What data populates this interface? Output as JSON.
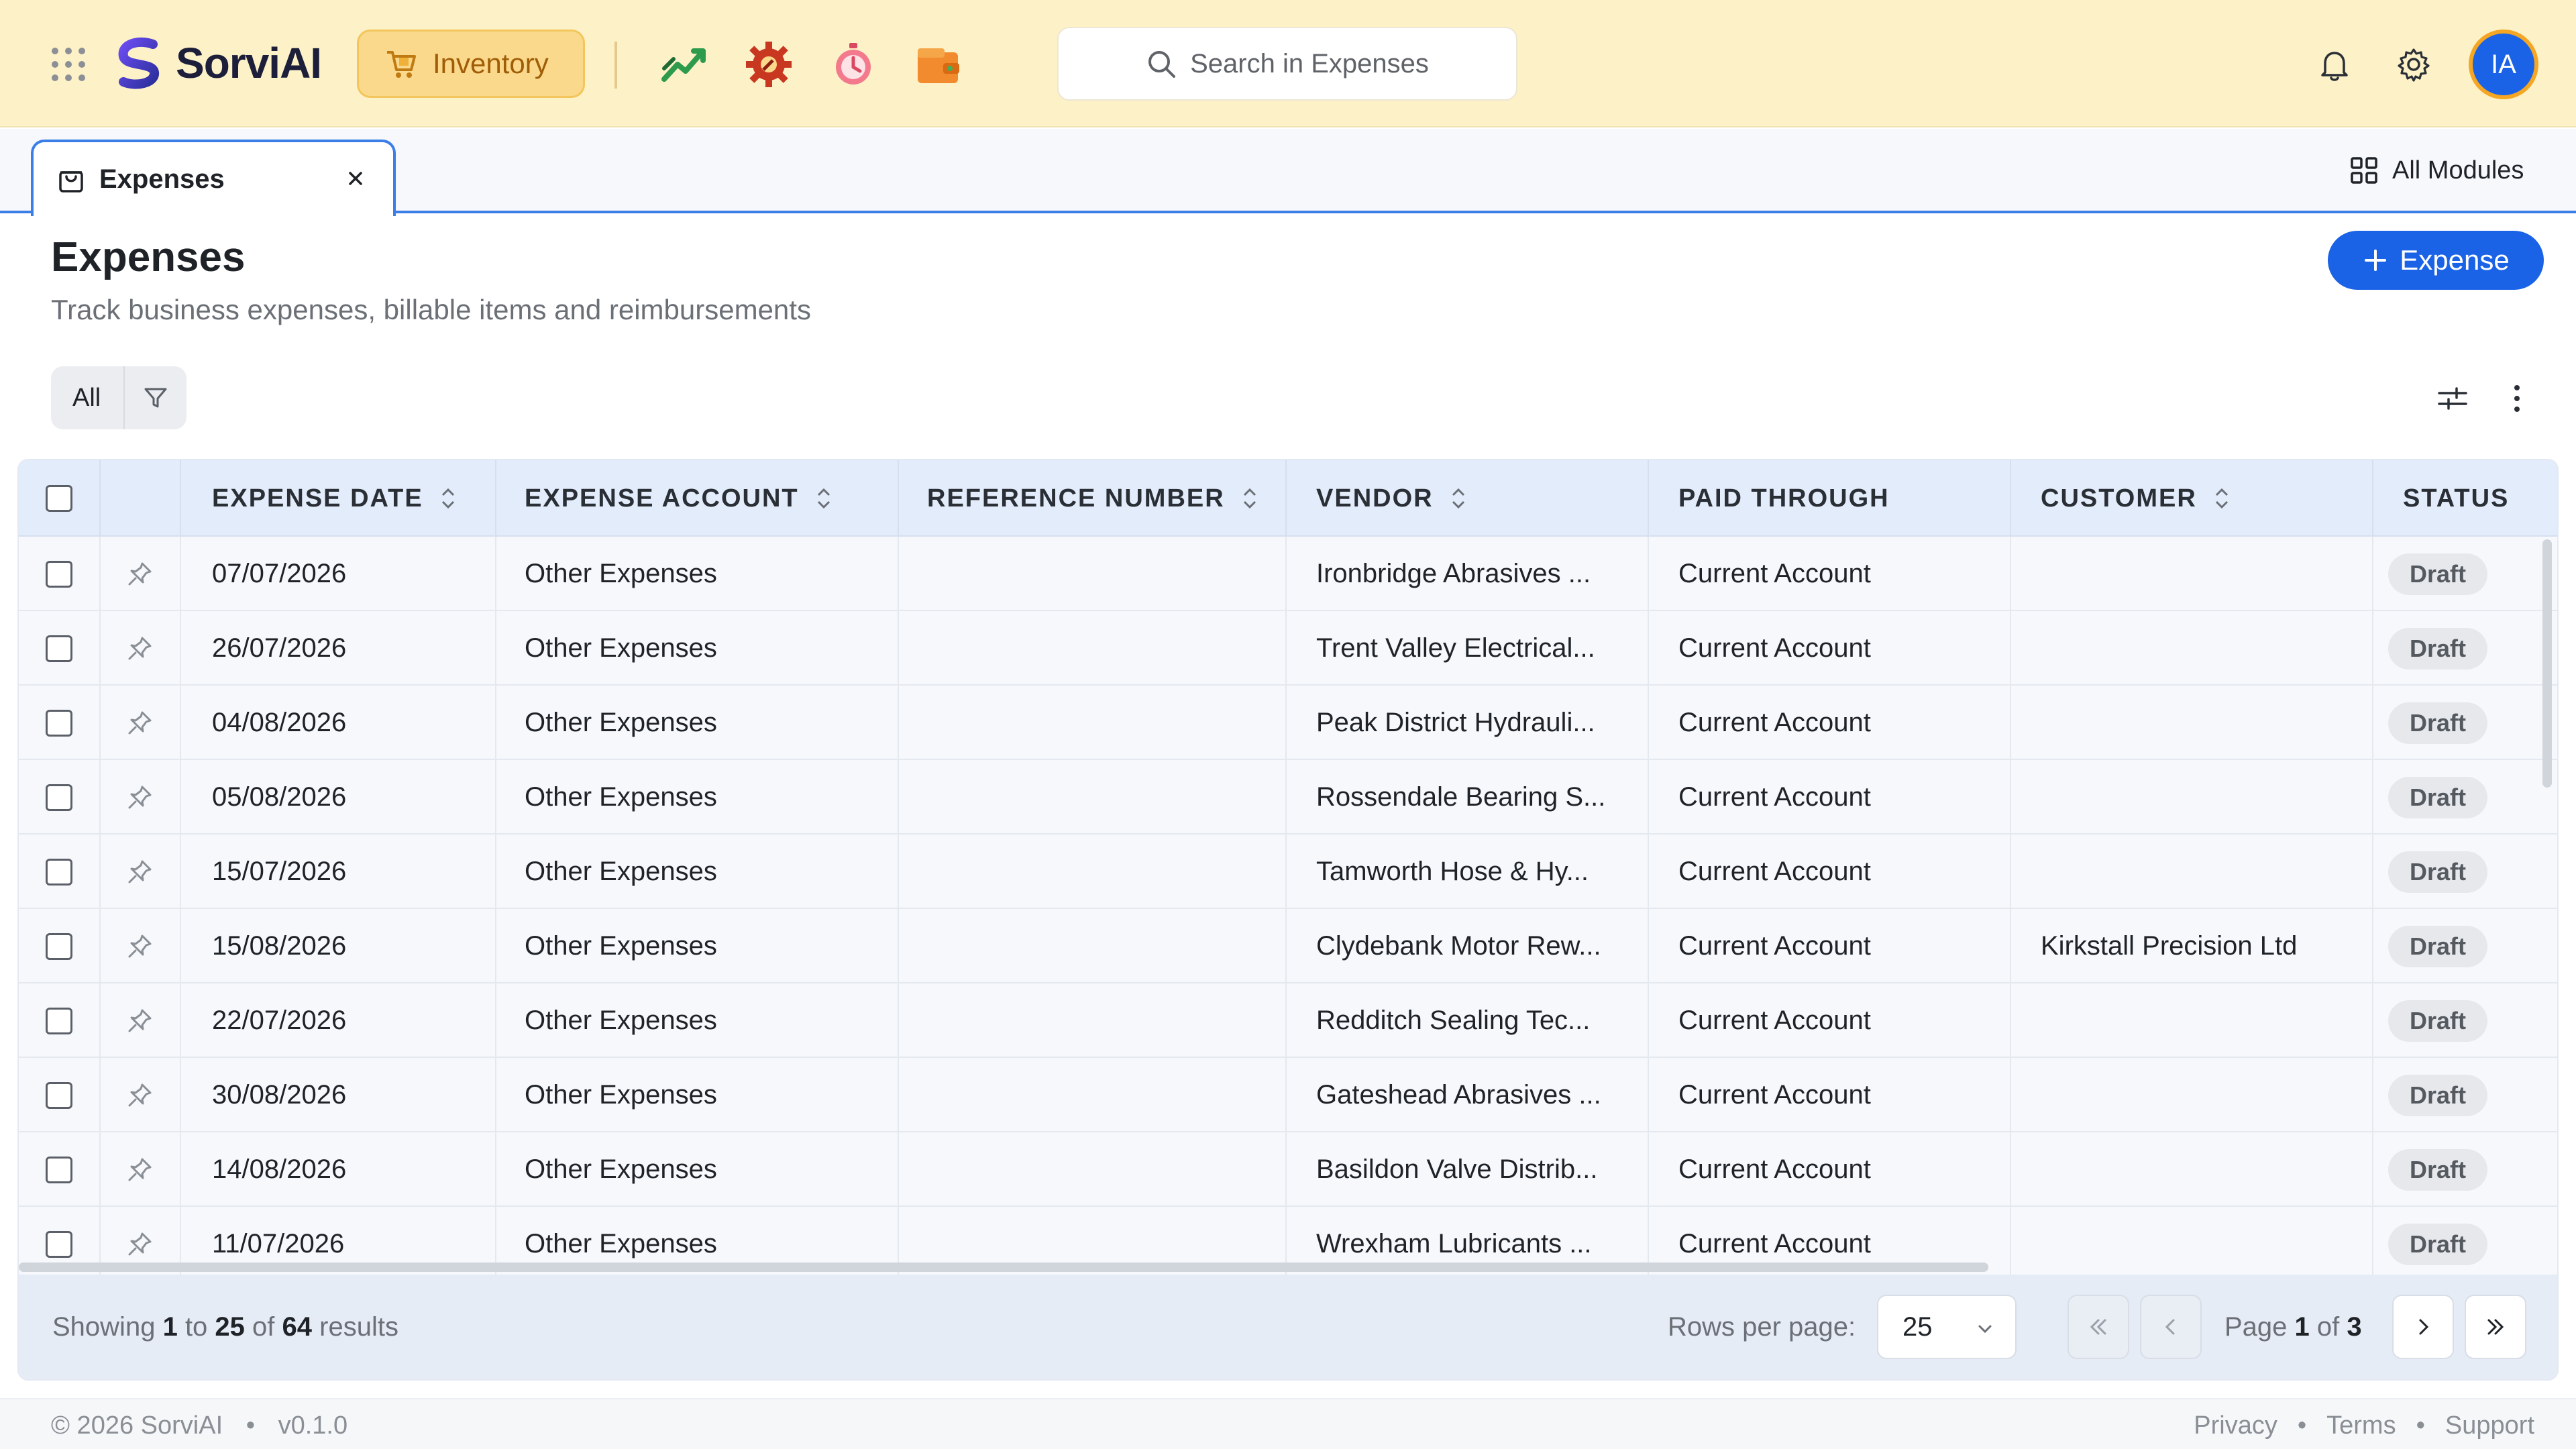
{
  "app": {
    "name": "SorviAI",
    "module_chip": "Inventory"
  },
  "search": {
    "placeholder": "Search in Expenses"
  },
  "user": {
    "initials": "IA"
  },
  "tab": {
    "label": "Expenses",
    "all_modules": "All Modules"
  },
  "page": {
    "title": "Expenses",
    "subtitle": "Track business expenses, billable items and reimbursements",
    "add_button": "Expense",
    "filter_label": "All"
  },
  "table": {
    "columns": [
      "EXPENSE DATE",
      "EXPENSE ACCOUNT",
      "REFERENCE NUMBER",
      "VENDOR",
      "PAID THROUGH",
      "CUSTOMER",
      "STATUS"
    ],
    "rows": [
      {
        "date": "07/07/2026",
        "account": "Other Expenses",
        "reference": "",
        "vendor": "Ironbridge Abrasives ...",
        "paid_through": "Current Account",
        "customer": "",
        "status": "Draft"
      },
      {
        "date": "26/07/2026",
        "account": "Other Expenses",
        "reference": "",
        "vendor": "Trent Valley Electrical...",
        "paid_through": "Current Account",
        "customer": "",
        "status": "Draft"
      },
      {
        "date": "04/08/2026",
        "account": "Other Expenses",
        "reference": "",
        "vendor": "Peak District Hydrauli...",
        "paid_through": "Current Account",
        "customer": "",
        "status": "Draft"
      },
      {
        "date": "05/08/2026",
        "account": "Other Expenses",
        "reference": "",
        "vendor": "Rossendale Bearing S...",
        "paid_through": "Current Account",
        "customer": "",
        "status": "Draft"
      },
      {
        "date": "15/07/2026",
        "account": "Other Expenses",
        "reference": "",
        "vendor": "Tamworth Hose & Hy...",
        "paid_through": "Current Account",
        "customer": "",
        "status": "Draft"
      },
      {
        "date": "15/08/2026",
        "account": "Other Expenses",
        "reference": "",
        "vendor": "Clydebank Motor Rew...",
        "paid_through": "Current Account",
        "customer": "Kirkstall Precision Ltd",
        "status": "Draft"
      },
      {
        "date": "22/07/2026",
        "account": "Other Expenses",
        "reference": "",
        "vendor": "Redditch Sealing Tec...",
        "paid_through": "Current Account",
        "customer": "",
        "status": "Draft"
      },
      {
        "date": "30/08/2026",
        "account": "Other Expenses",
        "reference": "",
        "vendor": "Gateshead Abrasives ...",
        "paid_through": "Current Account",
        "customer": "",
        "status": "Draft"
      },
      {
        "date": "14/08/2026",
        "account": "Other Expenses",
        "reference": "",
        "vendor": "Basildon Valve Distrib...",
        "paid_through": "Current Account",
        "customer": "",
        "status": "Draft"
      },
      {
        "date": "11/07/2026",
        "account": "Other Expenses",
        "reference": "",
        "vendor": "Wrexham Lubricants ...",
        "paid_through": "Current Account",
        "customer": "",
        "status": "Draft"
      }
    ]
  },
  "pagination": {
    "showing_prefix": "Showing",
    "from": "1",
    "to_word": "to",
    "to": "25",
    "of_word": "of",
    "total": "64",
    "results_word": "results",
    "rows_per_page_label": "Rows per page:",
    "rows_per_page": "25",
    "page_word": "Page",
    "current_page": "1",
    "page_of_word": "of",
    "total_pages": "3"
  },
  "footer": {
    "copyright": "© 2026 SorviAI",
    "version": "v0.1.0",
    "links": [
      "Privacy",
      "Terms",
      "Support"
    ]
  },
  "colors": {
    "accent": "#1b63e6",
    "topbar": "#fdf1c8",
    "chip": "#fbd98c"
  }
}
